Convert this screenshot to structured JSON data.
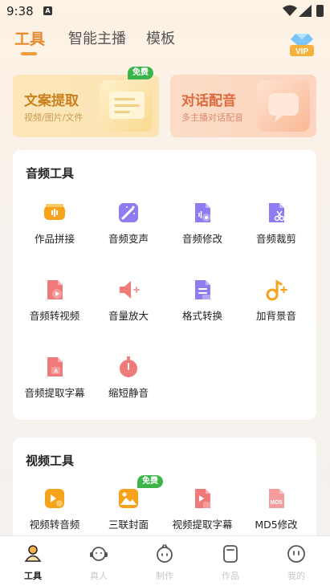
{
  "status_bar": {
    "time": "9:38",
    "notification_badge": "A"
  },
  "top_tabs": [
    {
      "label": "工具",
      "active": true
    },
    {
      "label": "智能主播",
      "active": false
    },
    {
      "label": "模板",
      "active": false
    }
  ],
  "vip_label": "VIP",
  "feature_cards": [
    {
      "title": "文案提取",
      "subtitle": "视频/图片/文件",
      "badge": "免费"
    },
    {
      "title": "对话配音",
      "subtitle": "多主播对话配音"
    }
  ],
  "audio_tools": {
    "title": "音频工具",
    "items": [
      {
        "label": "作品拼接",
        "icon": "merge-audio-icon"
      },
      {
        "label": "音频变声",
        "icon": "magic-wand-icon"
      },
      {
        "label": "音频修改",
        "icon": "audio-edit-icon"
      },
      {
        "label": "音频裁剪",
        "icon": "audio-cut-icon"
      },
      {
        "label": "音频转视频",
        "icon": "audio-to-video-icon"
      },
      {
        "label": "音量放大",
        "icon": "volume-up-icon"
      },
      {
        "label": "格式转换",
        "icon": "format-convert-icon"
      },
      {
        "label": "加背景音",
        "icon": "add-music-icon"
      },
      {
        "label": "音频提取字幕",
        "icon": "subtitle-extract-icon"
      },
      {
        "label": "缩短静音",
        "icon": "timer-icon"
      }
    ]
  },
  "video_tools": {
    "title": "视频工具",
    "items": [
      {
        "label": "视频转音频",
        "icon": "video-to-audio-icon"
      },
      {
        "label": "三联封面",
        "icon": "cover-image-icon",
        "badge": "免费"
      },
      {
        "label": "视频提取字幕",
        "icon": "video-subtitle-icon"
      },
      {
        "label": "MD5修改",
        "icon": "md5-icon"
      }
    ]
  },
  "bottom_nav": [
    {
      "label": "工具",
      "active": true
    },
    {
      "label": "真人",
      "active": false
    },
    {
      "label": "制作",
      "active": false
    },
    {
      "label": "作品",
      "active": false
    },
    {
      "label": "我的",
      "active": false
    }
  ],
  "colors": {
    "accent": "#e8892b",
    "free_badge": "#3bb54a",
    "icon_orange": "#f7a21b",
    "icon_purple": "#8f7cf0",
    "icon_red": "#f07979"
  }
}
